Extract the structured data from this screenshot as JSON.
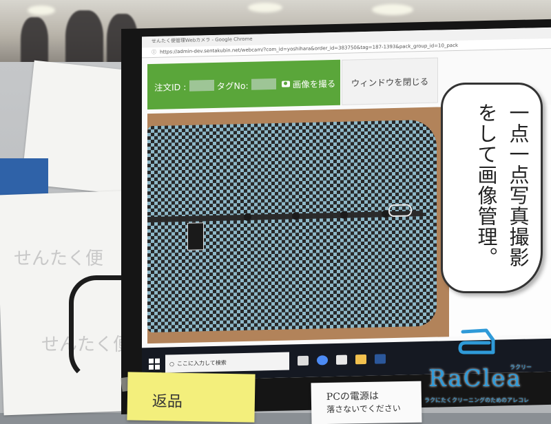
{
  "browser": {
    "title": "せんたく便管理Webカメラ - Google Chrome",
    "url": "https://admin-dev.sentakubin.net/webcam/?com_id=yoshihara&order_id=383750&tag=187-1393&pack_group_id=10_pack"
  },
  "toolbar": {
    "order_label": "注文ID :",
    "tag_label": "タグNo:",
    "capture_label": "画像を撮る",
    "close_label": "ウィンドウを閉じる"
  },
  "taskbar": {
    "search_placeholder": "ここに入力して検索"
  },
  "bubble": {
    "line1": "一点一点写真撮影",
    "line2": "をして画像管理。"
  },
  "brand": {
    "name": "RaClea",
    "kana": "ラクリー",
    "tagline": "ラクにたくクリーニングのためのアレコレ",
    "color": "#2f9ad8"
  },
  "background_text": {
    "form_title": "せんたく便",
    "sticky_left": "返品",
    "sticky_right_1": "PCの電源は",
    "sticky_right_2": "落さないでください"
  },
  "colors": {
    "green_bar": "#5aa63a",
    "taskbar": "#151922"
  },
  "icons": [
    "windows-icon",
    "search-icon",
    "camera-icon",
    "lock-icon",
    "chrome-icon",
    "mail-icon",
    "folder-icon",
    "word-icon"
  ]
}
